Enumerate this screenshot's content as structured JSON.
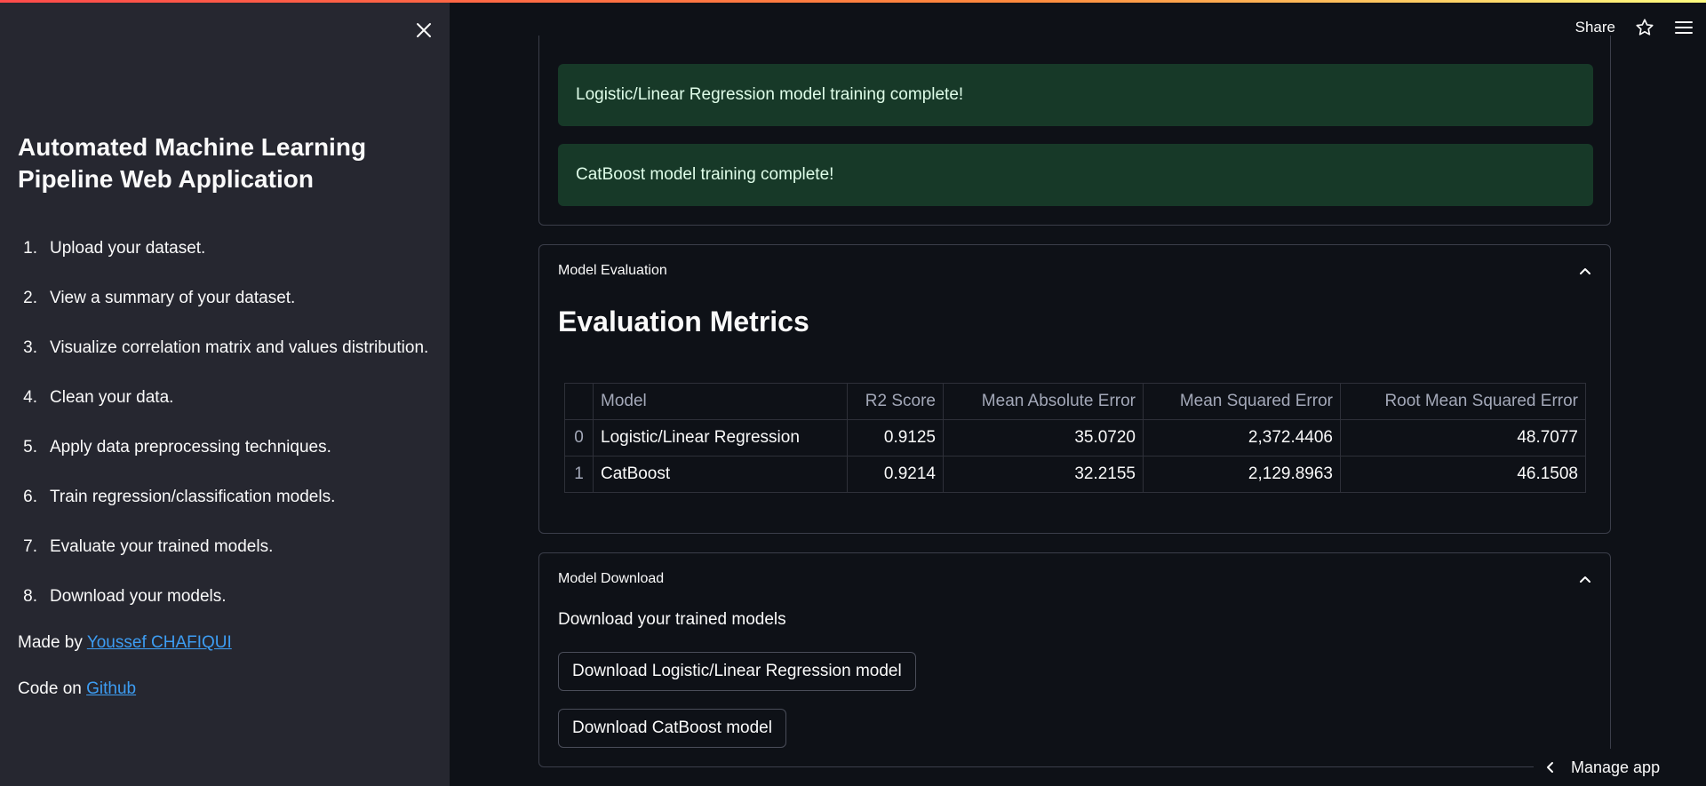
{
  "sidebar": {
    "title": "Automated Machine Learning Pipeline Web Application",
    "steps": [
      {
        "num": "1.",
        "text": "Upload your dataset."
      },
      {
        "num": "2.",
        "text": "View a summary of your dataset."
      },
      {
        "num": "3.",
        "text": "Visualize correlation matrix and values distribution."
      },
      {
        "num": "4.",
        "text": "Clean your data."
      },
      {
        "num": "5.",
        "text": "Apply data preprocessing techniques."
      },
      {
        "num": "6.",
        "text": "Train regression/classification models."
      },
      {
        "num": "7.",
        "text": "Evaluate your trained models."
      },
      {
        "num": "8.",
        "text": "Download your models."
      }
    ],
    "made_by_prefix": "Made by ",
    "made_by_link": "Youssef CHAFIQUI",
    "code_on_prefix": "Code on ",
    "code_on_link": "Github"
  },
  "header": {
    "share_label": "Share"
  },
  "training": {
    "messages": [
      "Logistic/Linear Regression model training complete!",
      "CatBoost model training complete!"
    ]
  },
  "evaluation": {
    "expander_label": "Model Evaluation",
    "heading": "Evaluation Metrics",
    "columns": [
      "",
      "Model",
      "R2 Score",
      "Mean Absolute Error",
      "Mean Squared Error",
      "Root Mean Squared Error"
    ],
    "rows": [
      [
        "0",
        "Logistic/Linear Regression",
        "0.9125",
        "35.0720",
        "2,372.4406",
        "48.7077"
      ],
      [
        "1",
        "CatBoost",
        "0.9214",
        "32.2155",
        "2,129.8963",
        "46.1508"
      ]
    ]
  },
  "download": {
    "expander_label": "Model Download",
    "text": "Download your trained models",
    "buttons": [
      "Download Logistic/Linear Regression model",
      "Download CatBoost model"
    ]
  },
  "footer": {
    "manage_app_label": "Manage app"
  },
  "colors": {
    "sidebar_bg": "#262730",
    "main_bg": "#0e1117",
    "success_bg": "#173928",
    "link": "#3d9df3",
    "accent": "#ff4b4b"
  }
}
